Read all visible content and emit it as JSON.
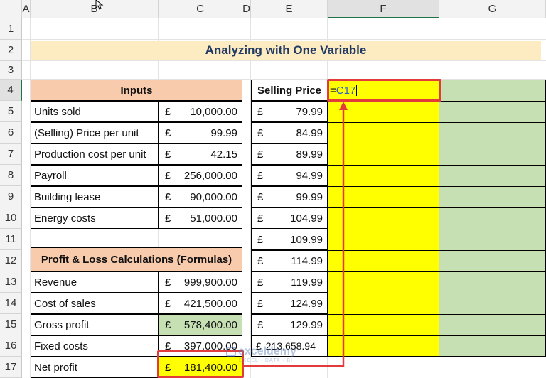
{
  "columns": {
    "corner": "",
    "a": "A",
    "b": "B",
    "c": "C",
    "d": "D",
    "e": "E",
    "f": "F",
    "g": "G"
  },
  "rows": [
    "1",
    "2",
    "3",
    "4",
    "5",
    "6",
    "7",
    "8",
    "9",
    "10",
    "11",
    "12",
    "13",
    "14",
    "15",
    "16",
    "17"
  ],
  "title": "Analyzing with One Variable",
  "inputs": {
    "header": "Inputs",
    "items": [
      {
        "label": "Units sold",
        "currency": "£",
        "value": "10,000.00"
      },
      {
        "label": "(Selling) Price per unit",
        "currency": "£",
        "value": "99.99"
      },
      {
        "label": "Production cost per unit",
        "currency": "£",
        "value": "42.15"
      },
      {
        "label": "Payroll",
        "currency": "£",
        "value": "256,000.00"
      },
      {
        "label": "Building lease",
        "currency": "£",
        "value": "90,000.00"
      },
      {
        "label": "Energy costs",
        "currency": "£",
        "value": "51,000.00"
      }
    ]
  },
  "pl": {
    "header": "Profit & Loss Calculations (Formulas)",
    "items": [
      {
        "label": "Revenue",
        "currency": "£",
        "value": "999,900.00"
      },
      {
        "label": "Cost of sales",
        "currency": "£",
        "value": "421,500.00"
      },
      {
        "label": "Gross profit",
        "currency": "£",
        "value": "578,400.00"
      },
      {
        "label": "Fixed costs",
        "currency": "£",
        "value": "397,000.00"
      },
      {
        "label": "Net profit",
        "currency": "£",
        "value": "181,400.00"
      }
    ]
  },
  "selling": {
    "header": "Selling Price",
    "items": [
      {
        "currency": "£",
        "value": "79.99"
      },
      {
        "currency": "£",
        "value": "84.99"
      },
      {
        "currency": "£",
        "value": "89.99"
      },
      {
        "currency": "£",
        "value": "94.99"
      },
      {
        "currency": "£",
        "value": "99.99"
      },
      {
        "currency": "£",
        "value": "104.99"
      },
      {
        "currency": "£",
        "value": "109.99"
      },
      {
        "currency": "£",
        "value": "114.99"
      },
      {
        "currency": "£",
        "value": "119.99"
      },
      {
        "currency": "£",
        "value": "124.99"
      },
      {
        "currency": "£",
        "value": "129.99"
      },
      {
        "currency": "£",
        "value": "213,658.94"
      }
    ]
  },
  "formula_cell": {
    "eq": "=",
    "ref": "C17"
  },
  "watermark": {
    "brand": "exceldemy",
    "tagline": "EXCEL · DATA · BI"
  },
  "colors": {
    "yellow": "#ffff00",
    "green": "#c6e0b4",
    "salmon": "#f8cbad",
    "title_bg": "#fdebc1",
    "highlight": "#e23b3b"
  }
}
